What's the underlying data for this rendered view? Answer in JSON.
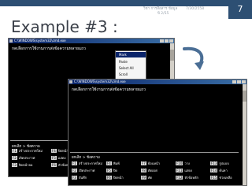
{
  "slide": {
    "page_number": "7",
    "meta_left": "วิชา การสื่อสาร ข้อมูล",
    "meta_left_2": "ปี 2/55",
    "meta_right": "7/30/2558",
    "title": "Example #3 :"
  },
  "console_small": {
    "window_title": "C:\\WINDOWS\\system32\\cmd.exe",
    "command_text": "กดเลือกการใช้งานการส่งข้อความหลายแถว",
    "context_menu": [
      "Mark",
      "Paste",
      "Select All",
      "Scroll",
      "Find..."
    ],
    "menu_header": "ยกเลิก > ข้อความ",
    "menu_items": [
      {
        "key": "F1",
        "label": "สร้างประกาศใหม่"
      },
      {
        "key": "F2",
        "label": "เปิดประกาศ"
      },
      {
        "key": "F3",
        "label": "ปิดหน้าจอ"
      },
      {
        "key": "F4",
        "label": "ปิดหน้า"
      },
      {
        "key": "F5",
        "label": "แสดง"
      },
      {
        "key": "F6",
        "label": "หัวข้อหลัก"
      }
    ]
  },
  "console_large": {
    "window_title": "C:\\WINDOWS\\system32\\cmd.exe",
    "command_text": "กดเลือกการใช้งานการส่งข้อความหลายแถว",
    "menu_header": "ยกเลิก > ข้อความ",
    "menu_items": [
      {
        "key": "F1",
        "label": "สร้างประกาศใหม่"
      },
      {
        "key": "F2",
        "label": "เปิดประกาศ"
      },
      {
        "key": "F3",
        "label": "บันทึก"
      },
      {
        "key": "F4",
        "label": "พิมพ์"
      },
      {
        "key": "F5",
        "label": "ปิด"
      },
      {
        "key": "F6",
        "label": "ปิดหน้า"
      },
      {
        "key": "F7",
        "label": "ย้อนหน้า"
      },
      {
        "key": "F8",
        "label": "ตัดออก"
      },
      {
        "key": "F9",
        "label": "คัด"
      },
      {
        "key": "F10",
        "label": "วาง"
      },
      {
        "key": "F11",
        "label": "แสดง"
      },
      {
        "key": "F12",
        "label": "หัวข้อหลัก"
      },
      {
        "key": "F13",
        "label": "รูปแบบ"
      },
      {
        "key": "F14",
        "label": "ค้นหา"
      },
      {
        "key": "F15",
        "label": "ช่วยเหลือ"
      }
    ]
  },
  "colors": {
    "accent": "#2d4f73",
    "arrow": "#4a6e95"
  },
  "icons": {
    "arrow": "curved-arrow-icon"
  }
}
